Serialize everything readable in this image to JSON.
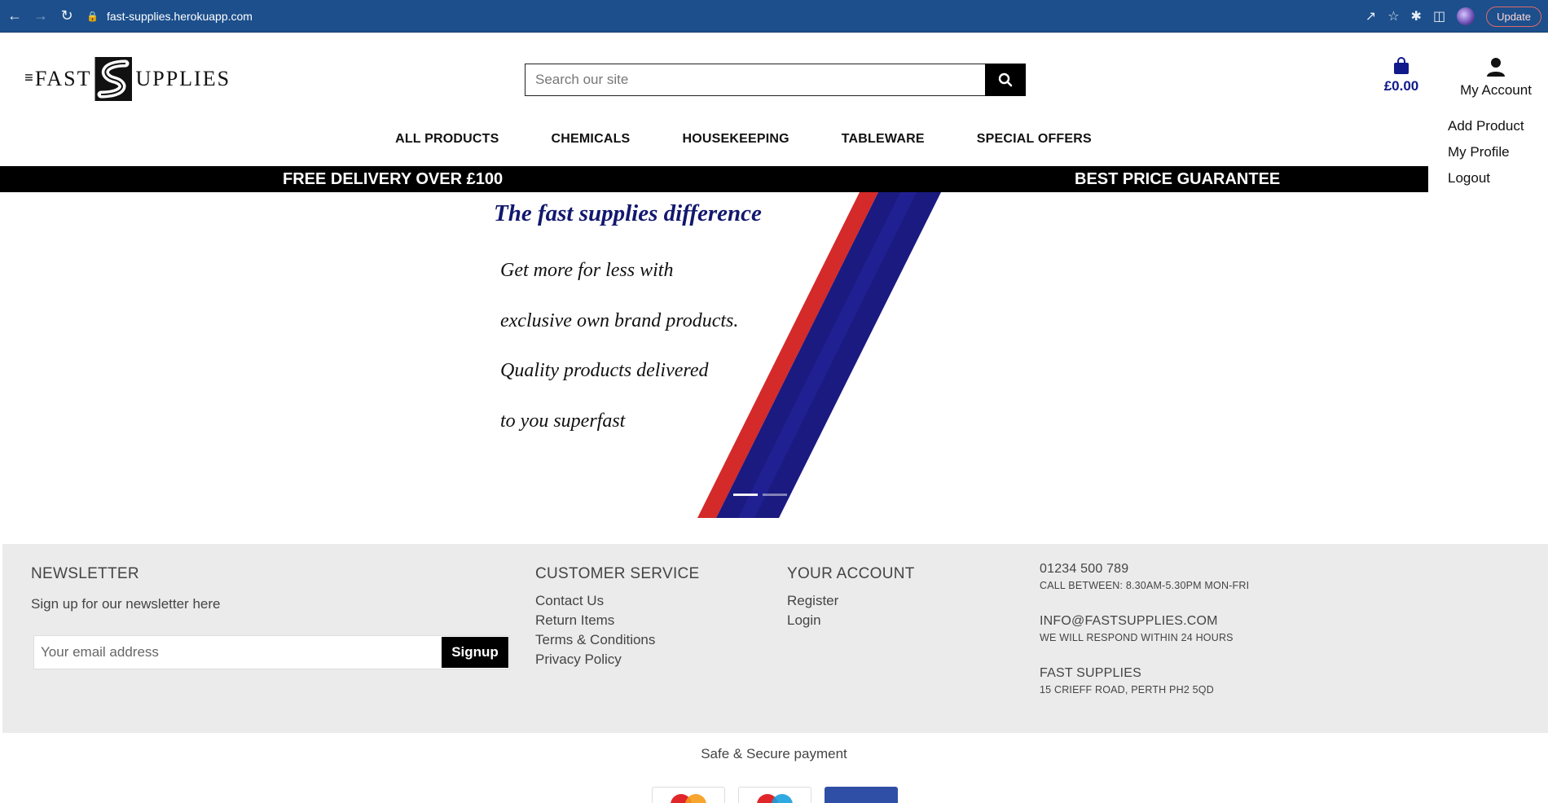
{
  "browser": {
    "url": "fast-supplies.herokuapp.com",
    "update_label": "Update"
  },
  "header": {
    "logo_left": "FAST",
    "logo_right": "UPPLIES",
    "search_placeholder": "Search our site",
    "cart_total": "£0.00",
    "account_label": "My Account",
    "account_menu": [
      "Add Product",
      "My Profile",
      "Logout"
    ]
  },
  "nav": {
    "items": [
      "ALL PRODUCTS",
      "CHEMICALS",
      "HOUSEKEEPING",
      "TABLEWARE",
      "SPECIAL OFFERS"
    ]
  },
  "promo": {
    "left": "FREE DELIVERY OVER £100",
    "right": "BEST PRICE GUARANTEE"
  },
  "hero": {
    "title": "The fast supplies difference",
    "lines": [
      "Get more for less with",
      "exclusive own brand products.",
      "Quality products delivered",
      "to you superfast"
    ],
    "colors": {
      "red": "#d42a2a",
      "navy": "#1a1a80"
    }
  },
  "footer": {
    "newsletter": {
      "heading": "NEWSLETTER",
      "subtext": "Sign up for our newsletter here",
      "placeholder": "Your email address",
      "button": "Signup"
    },
    "customer_service": {
      "heading": "CUSTOMER SERVICE",
      "links": [
        "Contact Us",
        "Return Items",
        "Terms & Conditions",
        "Privacy Policy"
      ]
    },
    "your_account": {
      "heading": "YOUR ACCOUNT",
      "links": [
        "Register",
        "Login"
      ]
    },
    "contact": {
      "phone": "01234 500 789",
      "phone_hours": "CALL BETWEEN: 8.30AM-5.30PM MON-FRI",
      "email": "INFO@FASTSUPPLIES.COM",
      "email_note": "WE WILL RESPOND WITHIN 24 HOURS",
      "company": "FAST SUPPLIES",
      "address": "15 CRIEFF ROAD, PERTH PH2 5QD"
    }
  },
  "payment": {
    "label": "Safe & Secure payment"
  }
}
